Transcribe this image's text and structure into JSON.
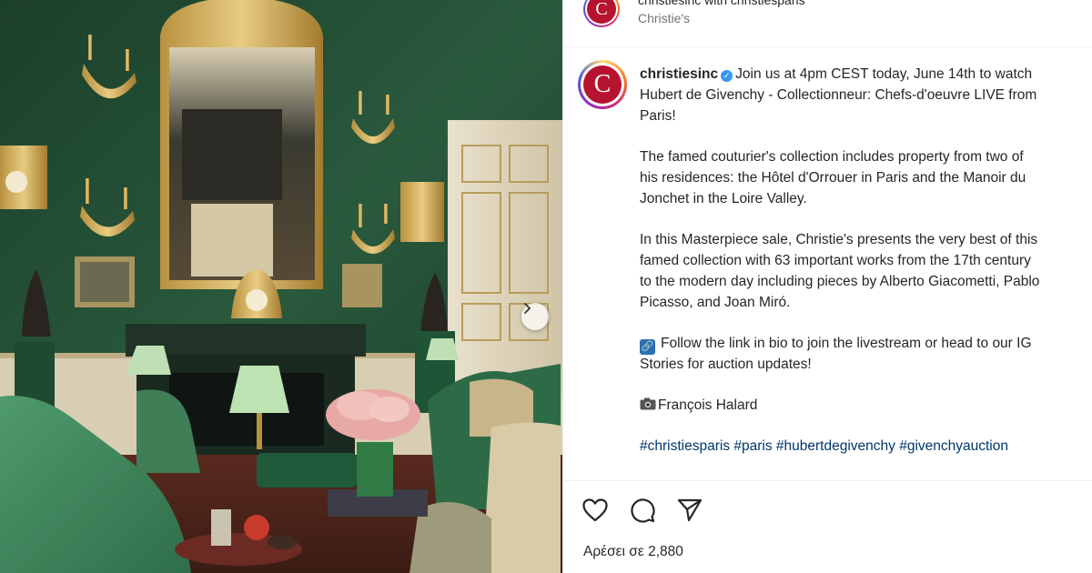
{
  "top_header": {
    "username": "christiesinc with christiesparis",
    "subtitle": "Christie's",
    "avatar_letter": "C"
  },
  "post": {
    "avatar_letter": "C",
    "username": "christiesinc",
    "verified_icon": "verified-badge-icon",
    "caption_lines": [
      "Join us at 4pm CEST today, June 14th to watch",
      "Hubert de Givenchy - Collectionneur: Chefs-d'oeuvre LIVE from",
      "Paris!"
    ],
    "paragraph2": [
      "The famed couturier's collection includes property from two of",
      "his residences: the Hôtel d'Orrouer in Paris and the Manoir du",
      "Jonchet in the Loire Valley."
    ],
    "paragraph3": [
      "In this Masterpiece sale, Christie's presents the very best of this",
      "famed collection with 63 important works from the 17th century",
      "to the modern day including pieces by Alberto Giacometti, Pablo",
      "Picasso, and Joan Miró."
    ],
    "paragraph4": [
      "Follow the link in bio to join the livestream or head to our IG",
      "Stories for auction updates!"
    ],
    "photo_credit": "François Halard",
    "hashtags": [
      "#christiesparis",
      "#paris",
      "#hubertdegivenchy",
      "#givenchyauction"
    ]
  },
  "actions": {
    "like_icon": "heart-icon",
    "comment_icon": "comment-icon",
    "share_icon": "send-icon"
  },
  "likes_text": "Αρέσει σε 2,880",
  "colors": {
    "link": "#00376b",
    "brand_red": "#b5132f",
    "verified": "#3897f0",
    "wall_green": "#244a34"
  }
}
